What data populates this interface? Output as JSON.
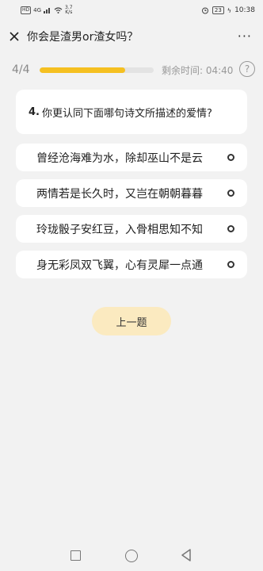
{
  "status_bar": {
    "hd_label": "HD",
    "signal_label": "4G",
    "speed_value": "3.7",
    "speed_unit": "K/s",
    "battery": "23",
    "time": "10:38"
  },
  "title_bar": {
    "title": "你会是渣男or渣女吗？",
    "more_label": "···"
  },
  "progress": {
    "count": "4/4",
    "fraction": 0.75,
    "timer": "剩余时间: 04:40",
    "help_label": "?"
  },
  "question": {
    "number": "4.",
    "text": "你更认同下面哪句诗文所描述的爱情?"
  },
  "options": [
    {
      "label": "曾经沧海难为水，除却巫山不是云"
    },
    {
      "label": "两情若是长久时，又岂在朝朝暮暮"
    },
    {
      "label": "玲珑骰子安红豆，入骨相思知不知"
    },
    {
      "label": "身无彩凤双飞翼，心有灵犀一点通"
    }
  ],
  "prev_button": {
    "label": "上一题"
  },
  "colors": {
    "accent": "#f5c021",
    "button_bg": "#fbeac0",
    "page_bg": "#f2f2f2"
  }
}
